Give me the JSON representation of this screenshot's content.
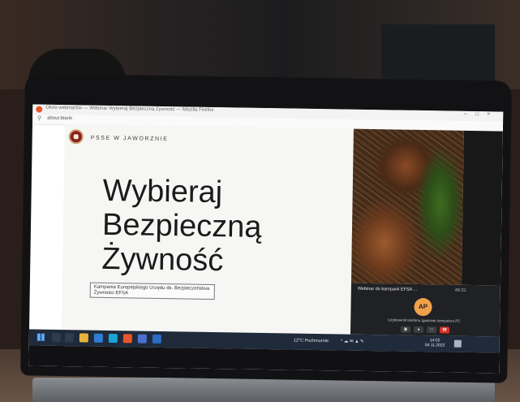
{
  "browser": {
    "window_title": "Okno webinarów — Webinar Wybieraj Bezpieczną Żywność — Mozilla Firefox",
    "window_controls": [
      "–",
      "□",
      "×"
    ],
    "address": "about:blank",
    "search_icon": "search-icon"
  },
  "slide": {
    "org_name": "PSSE W JAWORZNIE",
    "heading_line1": "Wybieraj",
    "heading_line2": "Bezpieczną",
    "heading_line3": "Żywność",
    "campaign_line1": "Kampania Europejskiego Urzędu ds. Bezpieczeństwa",
    "campaign_line2": "Żywności EFSA"
  },
  "call": {
    "webinar_title": "Webinar do kampanii EFSA ...",
    "timer": "46:31",
    "avatar_initials": "AP",
    "participant_label": "Użytkownik telefonu (gościnie komputera PC",
    "controls": [
      "camera-icon",
      "mic-icon",
      "share-icon",
      "hangup-icon"
    ],
    "hangup_color": "#d93025"
  },
  "taskbar": {
    "weather": "12°C Pochmurnie",
    "time": "14:02",
    "date": "04.11.2022"
  }
}
